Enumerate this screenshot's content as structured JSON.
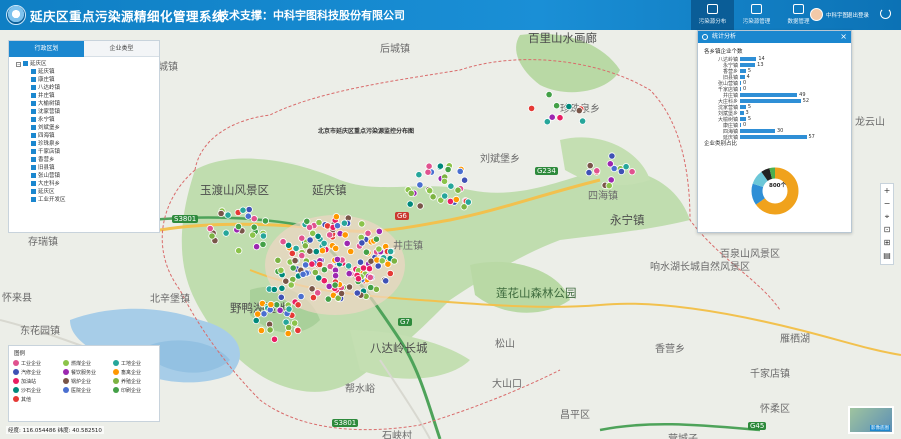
{
  "header": {
    "title": "延庆区重点污染源精细化管理系统",
    "tech_support": "技术支撑：中科宇图科技股份有限公司",
    "nav": [
      {
        "label": "污染源分布",
        "active": true
      },
      {
        "label": "污染源管理",
        "active": false
      },
      {
        "label": "数据管理",
        "active": false
      }
    ],
    "user_name": "中科宇图",
    "logout_label": "退出登录"
  },
  "map": {
    "places": [
      "百里山水画廊",
      "后城镇",
      "珍珠泉乡",
      "四海镇",
      "龙云山",
      "刘斌堡乡",
      "大榆树镇",
      "井庄镇",
      "玉渡山风景区",
      "八达岭长城",
      "野鸭湖湿地",
      "百泉山风景区",
      "响水湖长城自然风景区",
      "莲花山森林公园",
      "八达岭镇",
      "康庄镇",
      "张山营镇",
      "沈家营镇",
      "妫河森林公园",
      "松山",
      "古城村",
      "延庆镇",
      "永宁镇",
      "旧县镇",
      "香营乡",
      "大庄科乡",
      "千家店镇",
      "怀来县",
      "雁栖湖",
      "怀柔区",
      "昌平区",
      "石峡村",
      "帮水峪",
      "营城子",
      "存瑞镇",
      "北辛堡镇",
      "大山口",
      "东花园镇",
      "张家口",
      "北京市延庆区重点污染源监控分布图"
    ],
    "roads": [
      "G6",
      "G7",
      "S3801",
      "G234",
      "G45"
    ]
  },
  "left_panel": {
    "tabs": [
      "行政区划",
      "企业类型"
    ],
    "root_label": "延庆区",
    "items": [
      "延庆镇",
      "康庄镇",
      "八达岭镇",
      "井庄镇",
      "大榆树镇",
      "沈家营镇",
      "永宁镇",
      "刘斌堡乡",
      "四海镇",
      "珍珠泉乡",
      "千家店镇",
      "香营乡",
      "旧县镇",
      "张山营镇",
      "大庄科乡",
      "延庆区",
      "工业开发区"
    ]
  },
  "stats_panel": {
    "title": "统计分析",
    "close_label": "×",
    "bar_title": "各乡镇企业个数",
    "donut_title": "企业类别占比",
    "donut_center": "800个",
    "chart_data": [
      {
        "type": "bar",
        "title": "各乡镇企业个数",
        "categories": [
          "八达岭镇",
          "永宁镇",
          "香营乡",
          "旧县镇",
          "张山营镇",
          "千家店镇",
          "井庄镇",
          "大庄科乡",
          "沈家营镇",
          "刘斌堡乡",
          "大榆树镇",
          "康庄镇",
          "四海镇",
          "延庆镇"
        ],
        "values": [
          14,
          13,
          5,
          4,
          0,
          0,
          49,
          52,
          5,
          3,
          5,
          0,
          30,
          57
        ],
        "orientation": "horizontal"
      },
      {
        "type": "pie",
        "title": "企业类别占比",
        "center_label": "800个",
        "segments": [
          {
            "value": 65,
            "color": "#f0a21c"
          },
          {
            "value": 15,
            "color": "#2f8fd6"
          },
          {
            "value": 10,
            "color": "#6cc7d8"
          },
          {
            "value": 6,
            "color": "#222222"
          },
          {
            "value": 4,
            "color": "#4caf50"
          }
        ]
      }
    ]
  },
  "legend": {
    "title": "图例",
    "items": [
      {
        "label": "工业企业",
        "color": "#e0528f"
      },
      {
        "label": "燃煤企业",
        "color": "#8bc34a"
      },
      {
        "label": "工地企业",
        "color": "#26a69a"
      },
      {
        "label": "汽修企业",
        "color": "#3f51b5"
      },
      {
        "label": "餐饮服务业",
        "color": "#9c27b0"
      },
      {
        "label": "畜禽企业",
        "color": "#ff9800"
      },
      {
        "label": "加油站",
        "color": "#e91e63"
      },
      {
        "label": "锅炉企业",
        "color": "#795548"
      },
      {
        "label": "养殖企业",
        "color": "#7cb342"
      },
      {
        "label": "沙石企业",
        "color": "#00897b"
      },
      {
        "label": "医院企业",
        "color": "#4a6fd0"
      },
      {
        "label": "印刷企业",
        "color": "#43a047"
      },
      {
        "label": "其他",
        "color": "#e53935"
      }
    ]
  },
  "coords": "经度: 116.054486 纬度: 40.582510",
  "toolbar": [
    "+",
    "−",
    "⌖",
    "⊡",
    "⊞",
    "▤"
  ],
  "minimap_label": "影像底图"
}
